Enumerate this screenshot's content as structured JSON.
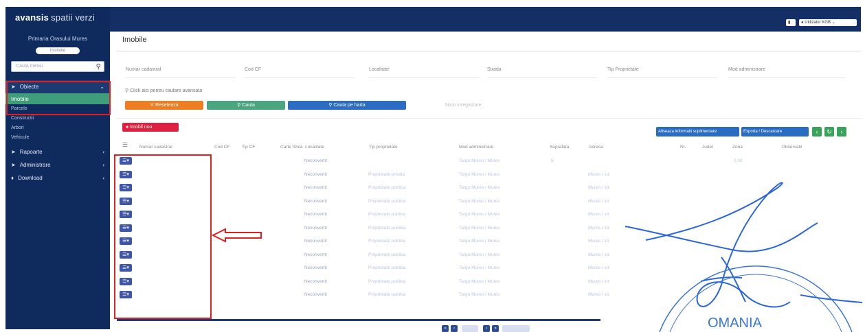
{
  "sidebar": {
    "brand": "avansis",
    "brand_sub": "spatii verzi",
    "org": "Primaria Orasului Mures",
    "pill": "Institutie",
    "search_placeholder": "Cauta meniu",
    "menu": [
      {
        "label": "Obiecte",
        "open": true
      },
      {
        "label": "Imobile",
        "active": true
      },
      {
        "label": "Parcele",
        "sub": true
      },
      {
        "label": "Constructii",
        "sub": true
      },
      {
        "label": "Arbori",
        "sub": true
      },
      {
        "label": "Vehicule",
        "sub": true
      },
      {
        "label": "Rapoarte"
      },
      {
        "label": "Administrare"
      },
      {
        "label": "Download"
      }
    ]
  },
  "topbar": {
    "user": "Utilizator KGB"
  },
  "page": {
    "title": "Imobile",
    "filters": [
      "Numar cadastral",
      "Cod CF",
      "Localitate",
      "Strada",
      "Tip Proprietate",
      "Mod administrare"
    ],
    "click_hint": "Click aici pentru cautare avansata",
    "buttons": {
      "reset": "Reseteaza",
      "search": "Cauta",
      "map_search": "Cauta pe harta"
    },
    "results_hint": "Nicio inregistrare",
    "new_button": "Imobil nou",
    "right_buttons": [
      "Afiseaza informatii suplimentare",
      "Exporta / Descarcare"
    ]
  },
  "table": {
    "headers": [
      "Numar cadastral",
      "Cod CF",
      "Tip CF",
      "Carte fizica",
      "Localitate",
      "Tip proprietate",
      "Mod administrare",
      "Suprafata",
      "Adresa",
      "Nr.",
      "Judet",
      "Zona",
      "Observatii"
    ],
    "rows": [
      {
        "cad": "",
        "tip": "Neconvertit",
        "prop": "",
        "loc": "Targu Mures / Mures",
        "sup": "5",
        "adr": "",
        "nr": "0,00"
      },
      {
        "cad": "",
        "tip": "Neconvertit",
        "prop": "Proprietate privata",
        "loc": "Targu Mures / Mures",
        "sup": "",
        "adr": "Mures / str.",
        "nr": ""
      },
      {
        "cad": "",
        "tip": "Neconvertit",
        "prop": "Proprietate publica",
        "loc": "Targu Mures / Mures",
        "sup": "",
        "adr": "Mures / str.",
        "nr": ""
      },
      {
        "cad": "",
        "tip": "Neconvertit",
        "prop": "Proprietate publica",
        "loc": "Targu Mures / Mures",
        "sup": "",
        "adr": "Mures / str.",
        "nr": ""
      },
      {
        "cad": "",
        "tip": "Neconvertit",
        "prop": "Proprietate publica",
        "loc": "Targu Mures / Mures",
        "sup": "",
        "adr": "Mures / str.",
        "nr": ""
      },
      {
        "cad": "",
        "tip": "Neconvertit",
        "prop": "Proprietate publica",
        "loc": "Targu Mures / Mures",
        "sup": "",
        "adr": "Mures / str.",
        "nr": ""
      },
      {
        "cad": "",
        "tip": "Neconvertit",
        "prop": "Proprietate publica",
        "loc": "Targu Mures / Mures",
        "sup": "",
        "adr": "Mures / str.",
        "nr": ""
      },
      {
        "cad": "",
        "tip": "Neconvertit",
        "prop": "Proprietate publica",
        "loc": "Targu Mures / Mures",
        "sup": "",
        "adr": "Mures / str.",
        "nr": ""
      },
      {
        "cad": "",
        "tip": "Neconvertit",
        "prop": "Proprietate publica",
        "loc": "Targu Mures / Mures",
        "sup": "",
        "adr": "Mures / str.",
        "nr": ""
      },
      {
        "cad": "",
        "tip": "Neconvertit",
        "prop": "Proprietate publica",
        "loc": "Targu Mures / Mures",
        "sup": "",
        "adr": "Mures / str.",
        "nr": ""
      },
      {
        "cad": "",
        "tip": "Neconvertit",
        "prop": "Proprietate publica",
        "loc": "Targu Mures / Mures",
        "sup": "",
        "adr": "Mures / str.",
        "nr": ""
      }
    ]
  },
  "stamp": {
    "text": "OMANIA"
  },
  "colors": {
    "sidebar": "#0f2b5e",
    "topbar": "#132f65",
    "active": "#3e9d7a",
    "highlight": "#e02020"
  }
}
